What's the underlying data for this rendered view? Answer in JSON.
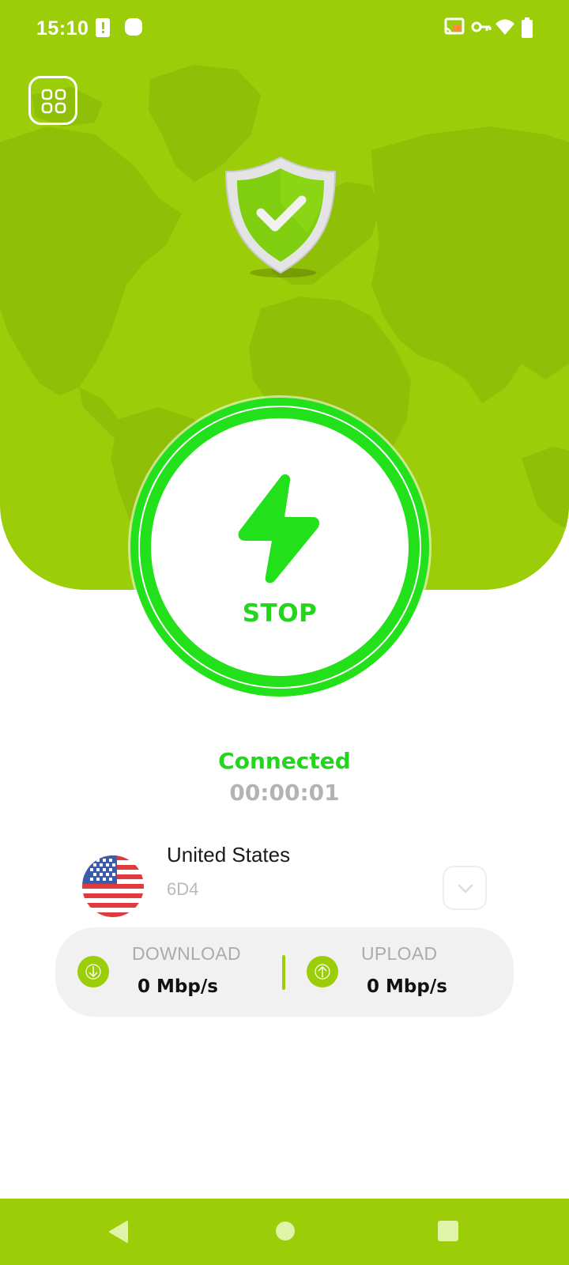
{
  "status_bar": {
    "time": "15:10",
    "icons": [
      "alert-icon",
      "circle-notification-icon",
      "cast-icon",
      "vpn-key-icon",
      "wifi-icon",
      "battery-icon"
    ]
  },
  "header": {
    "menu_icon": "grid-menu-icon",
    "shield_icon": "shield-check-icon",
    "background_color": "#9bcd08"
  },
  "power_button": {
    "label": "STOP",
    "icon": "lightning-bolt-icon",
    "color": "#22e01a"
  },
  "connection": {
    "status": "Connected",
    "timer": "00:00:01"
  },
  "server": {
    "country": "United States",
    "code": "6D4",
    "flag": "us-flag",
    "dropdown_icon": "chevron-down-icon"
  },
  "speed": {
    "download": {
      "label": "DOWNLOAD",
      "value": "0 Mbp/s",
      "icon": "arrow-down-icon"
    },
    "upload": {
      "label": "UPLOAD",
      "value": "0 Mbp/s",
      "icon": "arrow-up-icon"
    }
  },
  "nav_bar": {
    "buttons": [
      "back-icon",
      "home-icon",
      "recents-icon"
    ]
  }
}
